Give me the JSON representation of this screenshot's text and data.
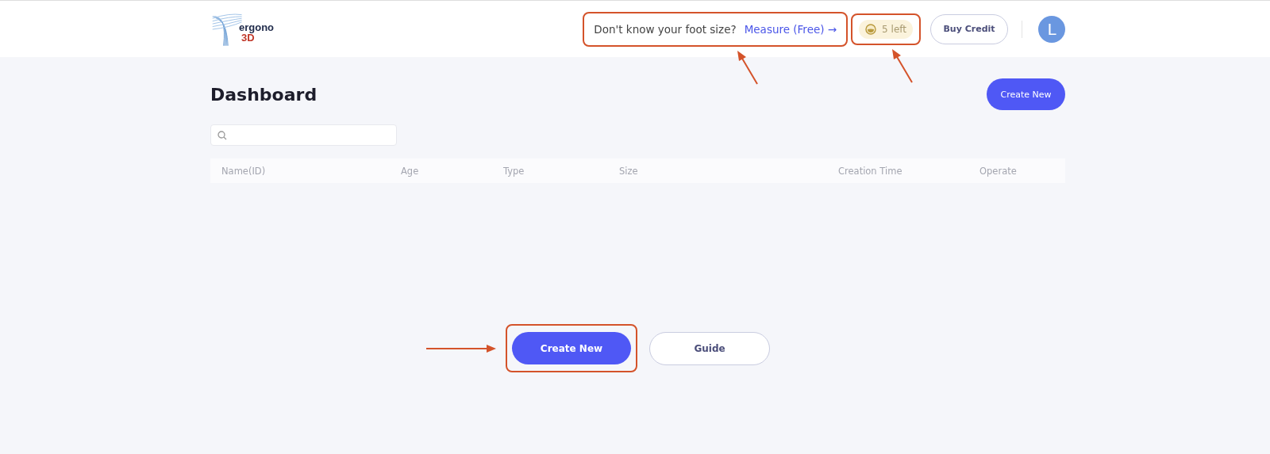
{
  "header": {
    "logo": {
      "word": "ergono",
      "suffix": "3D"
    },
    "measure_prompt": {
      "question": "Don't know your foot size?",
      "link": "Measure (Free)",
      "arrow": "→",
      "highlighted": true,
      "callout": {
        "kind": "below"
      }
    },
    "credits": {
      "label": "5 left",
      "highlighted": true,
      "callout": {
        "kind": "below"
      }
    },
    "buy_button": "Buy Credit",
    "avatar": "L"
  },
  "page": {
    "title": "Dashboard",
    "create_button": "Create New"
  },
  "table": {
    "columns": [
      "Name(ID)",
      "Age",
      "Type",
      "Size",
      "Creation Time",
      "Operate"
    ]
  },
  "empty_state": {
    "create_button": {
      "label": "Create New",
      "highlighted": true,
      "callout": {
        "kind": "left"
      }
    },
    "guide_button": "Guide"
  }
}
